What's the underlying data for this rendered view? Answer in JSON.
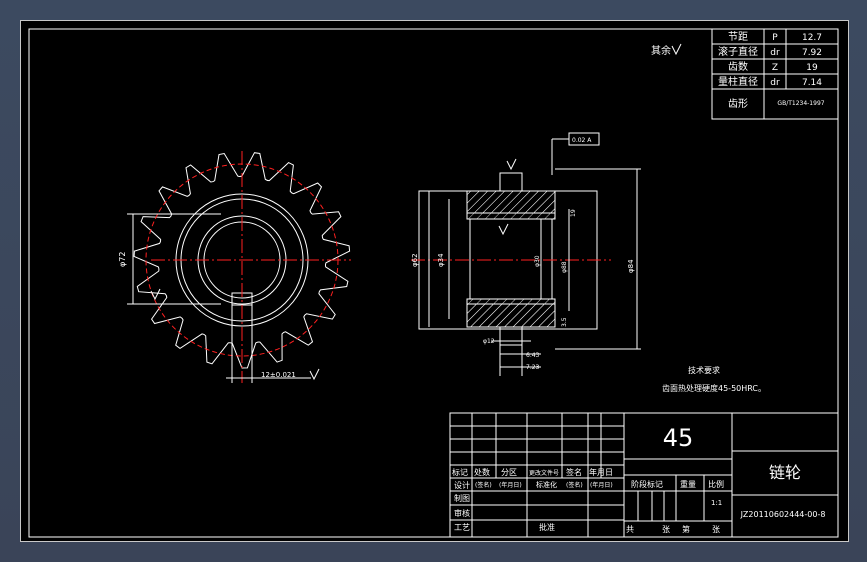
{
  "drawing": {
    "roughness_note": "其余",
    "sprocket_params": [
      {
        "name": "节距",
        "symbol": "P",
        "value": "12.7"
      },
      {
        "name": "滚子直径",
        "symbol": "dr",
        "value": "7.92"
      },
      {
        "name": "齿数",
        "symbol": "Z",
        "value": "19"
      },
      {
        "name": "量柱直径",
        "symbol": "dr",
        "value": "7.14"
      },
      {
        "name": "齿形",
        "symbol": "",
        "value": "GB/T1234-1997"
      }
    ],
    "tech_requirements": {
      "title": "技术要求",
      "line1": "齿面热处理硬度45-50HRC。"
    },
    "front_view": {
      "dim_diameter": "φ72",
      "dim_keyway": "12±0.021"
    },
    "section_view": {
      "dims_left": [
        "φ62",
        "φ34"
      ],
      "dims_inner": [
        "φ30",
        "φ88"
      ],
      "dims_right": [
        "φ84"
      ],
      "dim_bottom_a": "φ12",
      "dim_bottom_b": "6.43",
      "dim_bottom_c": "7.23",
      "dim_right_small": "19",
      "dim_right_small2": "3.5",
      "tolerance_box": "0.02 A"
    },
    "title_block": {
      "material": "45",
      "part_name": "链轮",
      "drawing_no": "JZ20110602444-00-8",
      "row_header": [
        "标记",
        "处数",
        "分区",
        "更改文件号",
        "签名",
        "年月日"
      ],
      "labels": {
        "design": "设计",
        "standard_label": "(签名)",
        "date_label": "(年月日)",
        "standardize": "标准化",
        "drawing": "制图",
        "review": "审核",
        "process": "工艺",
        "approve": "批准",
        "stage": "阶段标记",
        "weight": "重量",
        "scale": "比例",
        "scale_value": "1:1",
        "total": "共",
        "sheet": "张",
        "page_of": "第",
        "sheet2": "张"
      }
    }
  }
}
